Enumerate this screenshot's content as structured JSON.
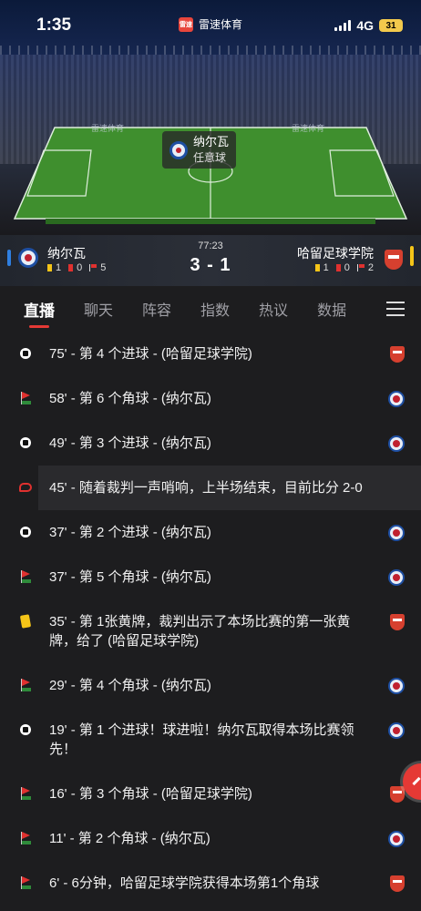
{
  "status_bar": {
    "time": "1:35",
    "app_name": "雷速体育",
    "app_logo_text": "雷速",
    "network": "4G",
    "battery": "31"
  },
  "field": {
    "ad_text": "雷速体育",
    "banner_team": "纳尔瓦",
    "banner_event": "任意球"
  },
  "match": {
    "home": {
      "name": "纳尔瓦",
      "yellow": "1",
      "red": "0",
      "corners": "5"
    },
    "away": {
      "name": "哈留足球学院",
      "yellow": "1",
      "red": "0",
      "corners": "2"
    },
    "clock": "77:23",
    "score": "3 - 1"
  },
  "tabs": [
    "直播",
    "聊天",
    "阵容",
    "指数",
    "热议",
    "数据"
  ],
  "events": [
    {
      "type": "goal",
      "text": "75' - 第 4 个进球 - (哈留足球学院)",
      "team": "away"
    },
    {
      "type": "corner",
      "text": "58' - 第 6 个角球 - (纳尔瓦)",
      "team": "home"
    },
    {
      "type": "goal",
      "text": "49' - 第 3 个进球 - (纳尔瓦)",
      "team": "home"
    },
    {
      "type": "whistle",
      "text": "45' - 随着裁判一声哨响，上半场结束，目前比分 2-0",
      "team": ""
    },
    {
      "type": "goal",
      "text": "37' - 第 2 个进球 - (纳尔瓦)",
      "team": "home"
    },
    {
      "type": "corner",
      "text": "37' - 第 5 个角球 - (纳尔瓦)",
      "team": "home"
    },
    {
      "type": "yellow",
      "text": "35' - 第 1张黄牌，裁判出示了本场比赛的第一张黄牌，给了 (哈留足球学院)",
      "team": "away"
    },
    {
      "type": "corner",
      "text": "29' - 第 4 个角球 - (纳尔瓦)",
      "team": "home"
    },
    {
      "type": "goal",
      "text": "19' - 第 1 个进球！球进啦！纳尔瓦取得本场比赛领先！",
      "team": "home"
    },
    {
      "type": "corner",
      "text": "16' - 第 3 个角球 - (哈留足球学院)",
      "team": "away"
    },
    {
      "type": "corner",
      "text": "11' - 第 2 个角球 - (纳尔瓦)",
      "team": "home"
    },
    {
      "type": "corner",
      "text": "6' - 6分钟，哈留足球学院获得本场第1个角球",
      "team": "away"
    }
  ]
}
